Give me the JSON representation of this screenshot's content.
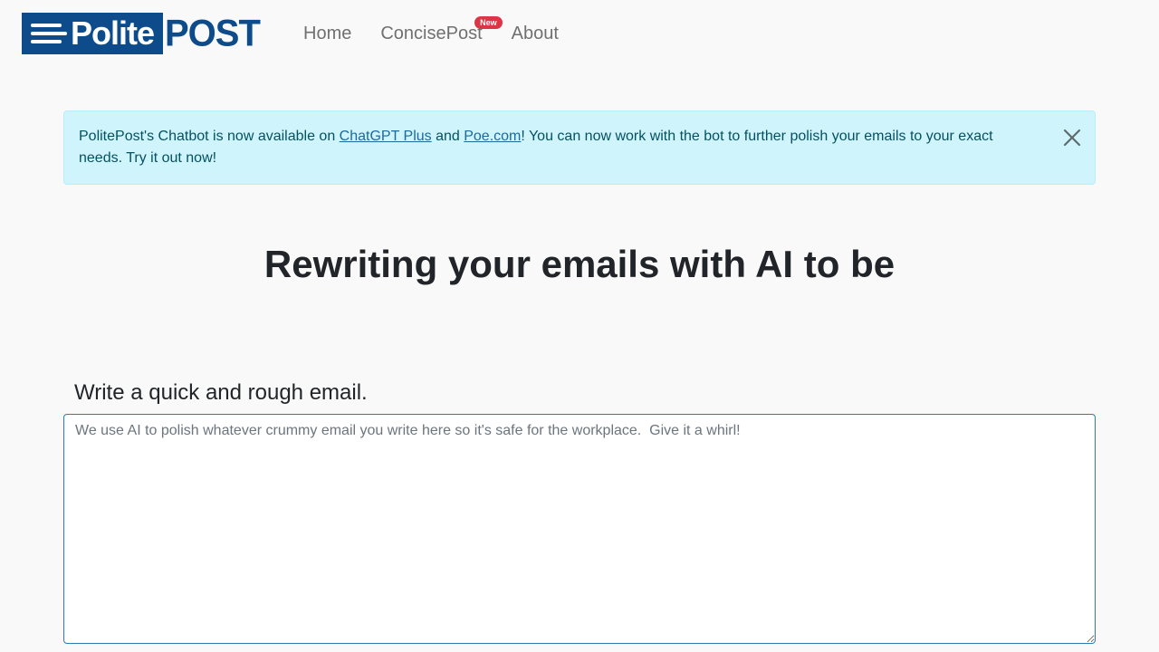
{
  "navbar": {
    "logo": {
      "left_text": "Polite",
      "right_text": "POST"
    },
    "links": [
      {
        "label": "Home"
      },
      {
        "label": "ConcisePost",
        "badge": "New"
      },
      {
        "label": "About"
      }
    ]
  },
  "alert": {
    "text_before": "PolitePost's Chatbot is now available on ",
    "link1": "ChatGPT Plus",
    "text_between": " and ",
    "link2": "Poe.com",
    "text_after": "! You can now work with the bot to further polish your emails to your exact needs. Try it out now!",
    "close_icon": "close-icon"
  },
  "hero": {
    "title": "Rewriting your emails with AI to be"
  },
  "form": {
    "label": "Write a quick and rough email.",
    "placeholder": "We use AI to polish whatever crummy email you write here so it's safe for the workplace.  Give it a whirl!",
    "value": ""
  },
  "colors": {
    "brand": "#0d4b8a",
    "alert_bg": "#cff4fc",
    "alert_text": "#055160",
    "badge": "#dc3545",
    "textarea_border": "#2c7cad"
  }
}
